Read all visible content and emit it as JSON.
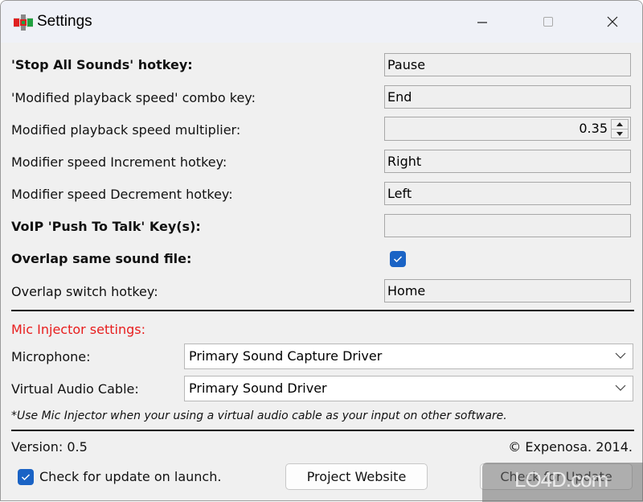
{
  "window": {
    "title": "Settings",
    "controls": {
      "minimize": "minimize",
      "maximize": "maximize",
      "close": "close"
    }
  },
  "settings": [
    {
      "label": "'Stop All Sounds' hotkey:",
      "value": "Pause",
      "bold": true
    },
    {
      "label": "'Modified playback speed' combo key:",
      "value": "End",
      "bold": false
    },
    {
      "label": "Modified playback speed multiplier:",
      "value": "0.35",
      "bold": false
    },
    {
      "label": "Modifier speed Increment hotkey:",
      "value": "Right",
      "bold": false
    },
    {
      "label": "Modifier speed Decrement hotkey:",
      "value": "Left",
      "bold": false
    },
    {
      "label": "VoIP 'Push To Talk' Key(s):",
      "value": "",
      "bold": true
    },
    {
      "label": "Overlap same sound file:",
      "checked": true,
      "bold": true
    },
    {
      "label": "Overlap switch hotkey:",
      "value": "Home",
      "bold": false
    }
  ],
  "mic_injector": {
    "title": "Mic Injector settings:",
    "microphone_label": "Microphone:",
    "microphone_value": "Primary Sound Capture Driver",
    "cable_label": "Virtual Audio Cable:",
    "cable_value": "Primary Sound Driver",
    "note": "*Use Mic Injector when your using a virtual audio cable as your input on other software."
  },
  "footer": {
    "version": "Version: 0.5",
    "copyright": "© Expenosa. 2014.",
    "check_on_launch_label": "Check for update on launch.",
    "check_on_launch_checked": true,
    "project_website_label": "Project Website",
    "check_update_label": "Check for Update"
  },
  "watermark": {
    "text": "LO4D.com"
  },
  "colors": {
    "accent": "#1a63c5",
    "section_title": "#e81d1d"
  }
}
